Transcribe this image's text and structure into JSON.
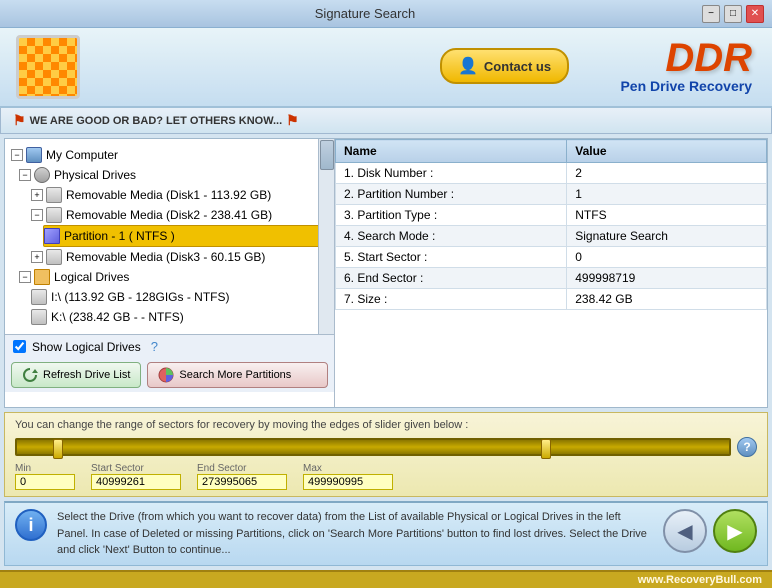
{
  "titlebar": {
    "title": "Signature Search",
    "min_label": "−",
    "max_label": "□",
    "close_label": "✕"
  },
  "header": {
    "contact_label": "Contact us",
    "brand_title": "DDR",
    "brand_subtitle": "Pen Drive Recovery"
  },
  "rating_bar": {
    "text": "WE ARE GOOD OR BAD?  LET OTHERS KNOW..."
  },
  "tree": {
    "root": "My Computer",
    "physical_drives": "Physical Drives",
    "drive1": "Removable Media (Disk1 - 113.92 GB)",
    "drive2": "Removable Media (Disk2 - 238.41 GB)",
    "partition1": "Partition - 1 ( NTFS )",
    "drive3": "Removable Media (Disk3 - 60.15 GB)",
    "logical_drives": "Logical Drives",
    "logical1": "I:\\ (113.92 GB - 128GIGs - NTFS)",
    "logical2": "K:\\ (238.42 GB -  - NTFS)"
  },
  "show_logical": {
    "label": "Show Logical Drives"
  },
  "buttons": {
    "refresh": "Refresh Drive List",
    "search": "Search More Partitions"
  },
  "detail_table": {
    "col_name": "Name",
    "col_value": "Value",
    "rows": [
      {
        "name": "1. Disk Number :",
        "value": "2"
      },
      {
        "name": "2. Partition Number :",
        "value": "1"
      },
      {
        "name": "3. Partition Type :",
        "value": "NTFS"
      },
      {
        "name": "4. Search Mode :",
        "value": "Signature Search"
      },
      {
        "name": "5. Start Sector :",
        "value": "0"
      },
      {
        "name": "6. End Sector :",
        "value": "499998719"
      },
      {
        "name": "7. Size :",
        "value": "238.42 GB"
      }
    ]
  },
  "slider": {
    "hint": "You can change the range of sectors for recovery by moving the edges of slider given below :",
    "min_label": "Min",
    "start_label": "Start Sector",
    "end_label": "End Sector",
    "max_label": "Max",
    "min_val": "0",
    "start_val": "40999261",
    "end_val": "273995065",
    "max_val": "499990995"
  },
  "info": {
    "text": "Select the Drive (from which you want to recover data) from the List of available Physical or Logical Drives in the left Panel. In case of Deleted or missing Partitions, click on 'Search More Partitions' button to find lost drives. Select the Drive and click 'Next' Button to continue..."
  },
  "footer": {
    "url": "www.RecoveryBull.com"
  }
}
